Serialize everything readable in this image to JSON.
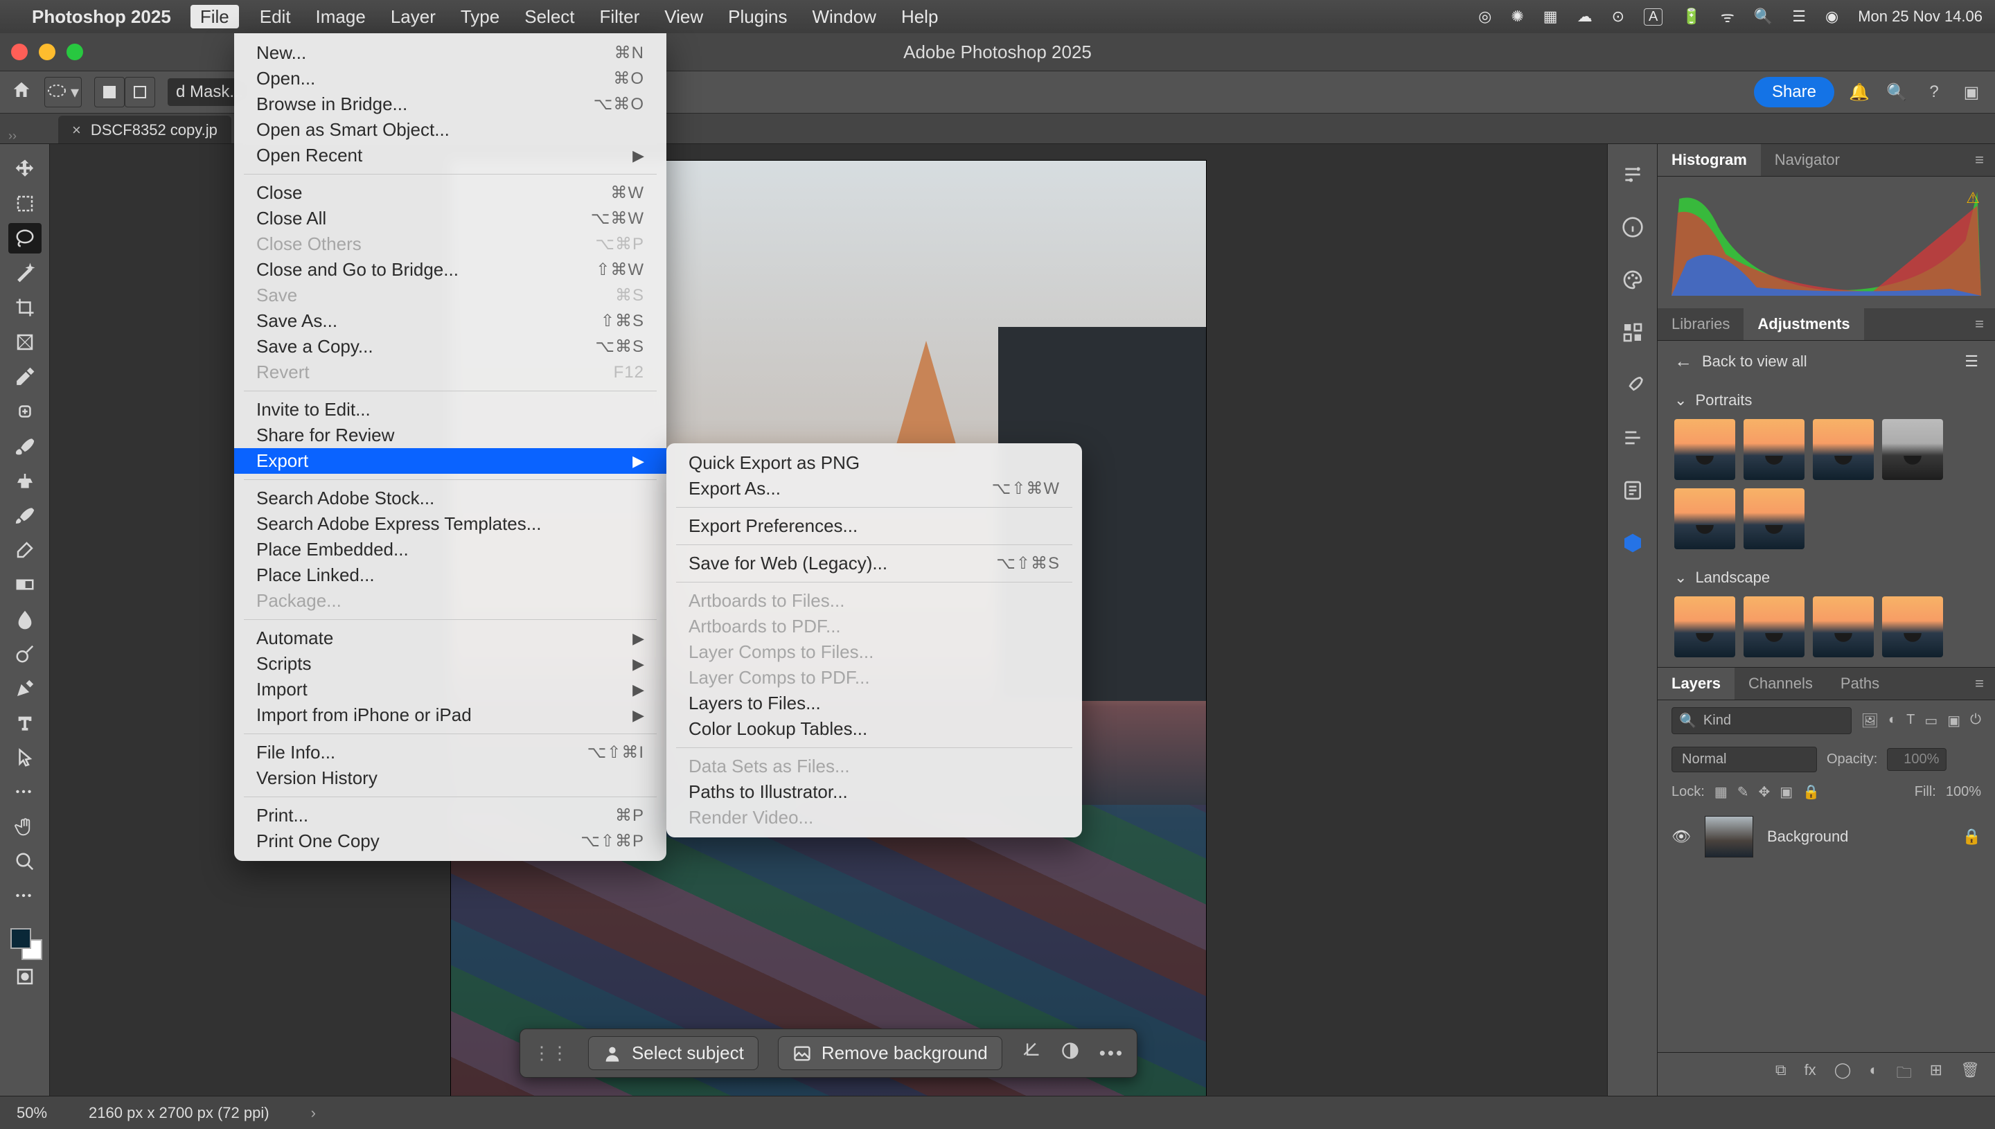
{
  "mac": {
    "app": "Photoshop 2025",
    "menus": [
      "File",
      "Edit",
      "Image",
      "Layer",
      "Type",
      "Select",
      "Filter",
      "View",
      "Plugins",
      "Window",
      "Help"
    ],
    "active_menu_index": 0,
    "clock": "Mon 25 Nov  14.06"
  },
  "window": {
    "title": "Adobe Photoshop 2025"
  },
  "options_bar": {
    "mask_chip": "d Mask...",
    "share": "Share"
  },
  "doc_tab": {
    "name": "DSCF8352 copy.jp",
    "close": "×"
  },
  "status": {
    "zoom": "50%",
    "dims": "2160 px x 2700 px (72 ppi)"
  },
  "context_bar": {
    "select_subject": "Select subject",
    "remove_bg": "Remove background"
  },
  "file_menu": [
    {
      "label": "New...",
      "sc": "⌘N"
    },
    {
      "label": "Open...",
      "sc": "⌘O"
    },
    {
      "label": "Browse in Bridge...",
      "sc": "⌥⌘O"
    },
    {
      "label": "Open as Smart Object..."
    },
    {
      "label": "Open Recent",
      "chev": true
    },
    {
      "sep": true
    },
    {
      "label": "Close",
      "sc": "⌘W"
    },
    {
      "label": "Close All",
      "sc": "⌥⌘W"
    },
    {
      "label": "Close Others",
      "sc": "⌥⌘P",
      "disabled": true
    },
    {
      "label": "Close and Go to Bridge...",
      "sc": "⇧⌘W"
    },
    {
      "label": "Save",
      "sc": "⌘S",
      "disabled": true
    },
    {
      "label": "Save As...",
      "sc": "⇧⌘S"
    },
    {
      "label": "Save a Copy...",
      "sc": "⌥⌘S"
    },
    {
      "label": "Revert",
      "sc": "F12",
      "disabled": true
    },
    {
      "sep": true
    },
    {
      "label": "Invite to Edit..."
    },
    {
      "label": "Share for Review"
    },
    {
      "label": "Export",
      "chev": true,
      "highlight": true
    },
    {
      "sep": true
    },
    {
      "label": "Search Adobe Stock..."
    },
    {
      "label": "Search Adobe Express Templates..."
    },
    {
      "label": "Place Embedded..."
    },
    {
      "label": "Place Linked..."
    },
    {
      "label": "Package...",
      "disabled": true
    },
    {
      "sep": true
    },
    {
      "label": "Automate",
      "chev": true
    },
    {
      "label": "Scripts",
      "chev": true
    },
    {
      "label": "Import",
      "chev": true
    },
    {
      "label": "Import from iPhone or iPad",
      "chev": true
    },
    {
      "sep": true
    },
    {
      "label": "File Info...",
      "sc": "⌥⇧⌘I"
    },
    {
      "label": "Version History"
    },
    {
      "sep": true
    },
    {
      "label": "Print...",
      "sc": "⌘P"
    },
    {
      "label": "Print One Copy",
      "sc": "⌥⇧⌘P"
    }
  ],
  "export_menu": [
    {
      "label": "Quick Export as PNG"
    },
    {
      "label": "Export As...",
      "sc": "⌥⇧⌘W"
    },
    {
      "sep": true
    },
    {
      "label": "Export Preferences..."
    },
    {
      "sep": true
    },
    {
      "label": "Save for Web (Legacy)...",
      "sc": "⌥⇧⌘S"
    },
    {
      "sep": true
    },
    {
      "label": "Artboards to Files...",
      "disabled": true
    },
    {
      "label": "Artboards to PDF...",
      "disabled": true
    },
    {
      "label": "Layer Comps to Files...",
      "disabled": true
    },
    {
      "label": "Layer Comps to PDF...",
      "disabled": true
    },
    {
      "label": "Layers to Files..."
    },
    {
      "label": "Color Lookup Tables..."
    },
    {
      "sep": true
    },
    {
      "label": "Data Sets as Files...",
      "disabled": true
    },
    {
      "label": "Paths to Illustrator..."
    },
    {
      "label": "Render Video...",
      "disabled": true
    }
  ],
  "panels": {
    "hist_tabs": [
      "Histogram",
      "Navigator"
    ],
    "lib_tabs": [
      "Libraries",
      "Adjustments"
    ],
    "back_to_view": "Back to view all",
    "portraits": "Portraits",
    "landscape": "Landscape",
    "layer_tabs": [
      "Layers",
      "Channels",
      "Paths"
    ],
    "kind": "Kind",
    "blend": "Normal",
    "opacity_label": "Opacity:",
    "opacity_value": "100%",
    "lock_label": "Lock:",
    "fill_label": "Fill:",
    "fill_value": "100%",
    "bg_layer": "Background"
  }
}
